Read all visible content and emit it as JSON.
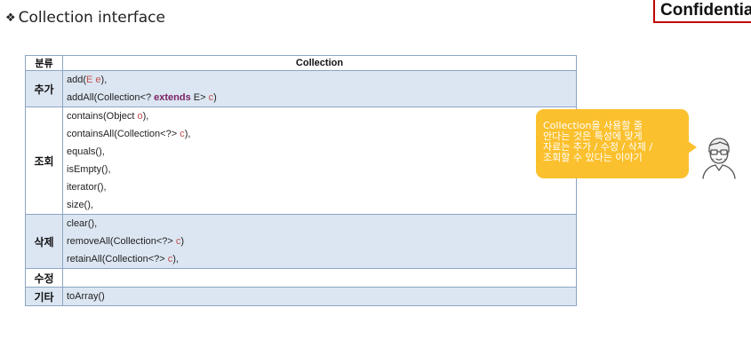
{
  "slide": {
    "heading_bullet": "❖",
    "heading": "Collection interface",
    "confidential_label": "Confidential"
  },
  "table": {
    "header_category": "분류",
    "header_title": "Collection",
    "rows": [
      {
        "category": "추가",
        "shaded": true,
        "methods": [
          {
            "name": "add(",
            "param": "E e",
            "close": "),"
          },
          {
            "name": "addAll(Collection<? ",
            "keyword": "extends",
            "after_keyword": " E> ",
            "param": "c",
            "close": ")"
          }
        ]
      },
      {
        "category": "조회",
        "shaded": false,
        "methods": [
          {
            "name": "contains(Object ",
            "param": "o",
            "close": "),"
          },
          {
            "name": "containsAll(Collection<?> ",
            "param": "c",
            "close": "),"
          },
          {
            "name": "equals(),"
          },
          {
            "name": "isEmpty(),"
          },
          {
            "name": "iterator(),"
          },
          {
            "name": "size(),"
          }
        ]
      },
      {
        "category": "삭제",
        "shaded": true,
        "methods": [
          {
            "name": "clear(),"
          },
          {
            "name": "removeAll(Collection<?> ",
            "param": "c",
            "close": ")"
          },
          {
            "name": "retainAll(Collection<?> ",
            "param": "c",
            "close": "),"
          }
        ]
      },
      {
        "category": "수정",
        "shaded": false,
        "methods": []
      },
      {
        "category": "기타",
        "shaded": true,
        "methods": [
          {
            "name": "toArray()"
          }
        ]
      }
    ]
  },
  "callout": {
    "lines": [
      "Collection을 사용할 줄",
      "안다는 것은 특성에 맞게",
      "자료는 추가 / 수정 / 삭제 /",
      "조회할 수 있다는 이야기"
    ]
  },
  "colors": {
    "shaded_row": "#dce6f2",
    "border": "#8ca6c4",
    "param": "#c0504d",
    "keyword": "#7a2163",
    "callout": "#fbc02d",
    "confidential_border": "#c00000"
  }
}
